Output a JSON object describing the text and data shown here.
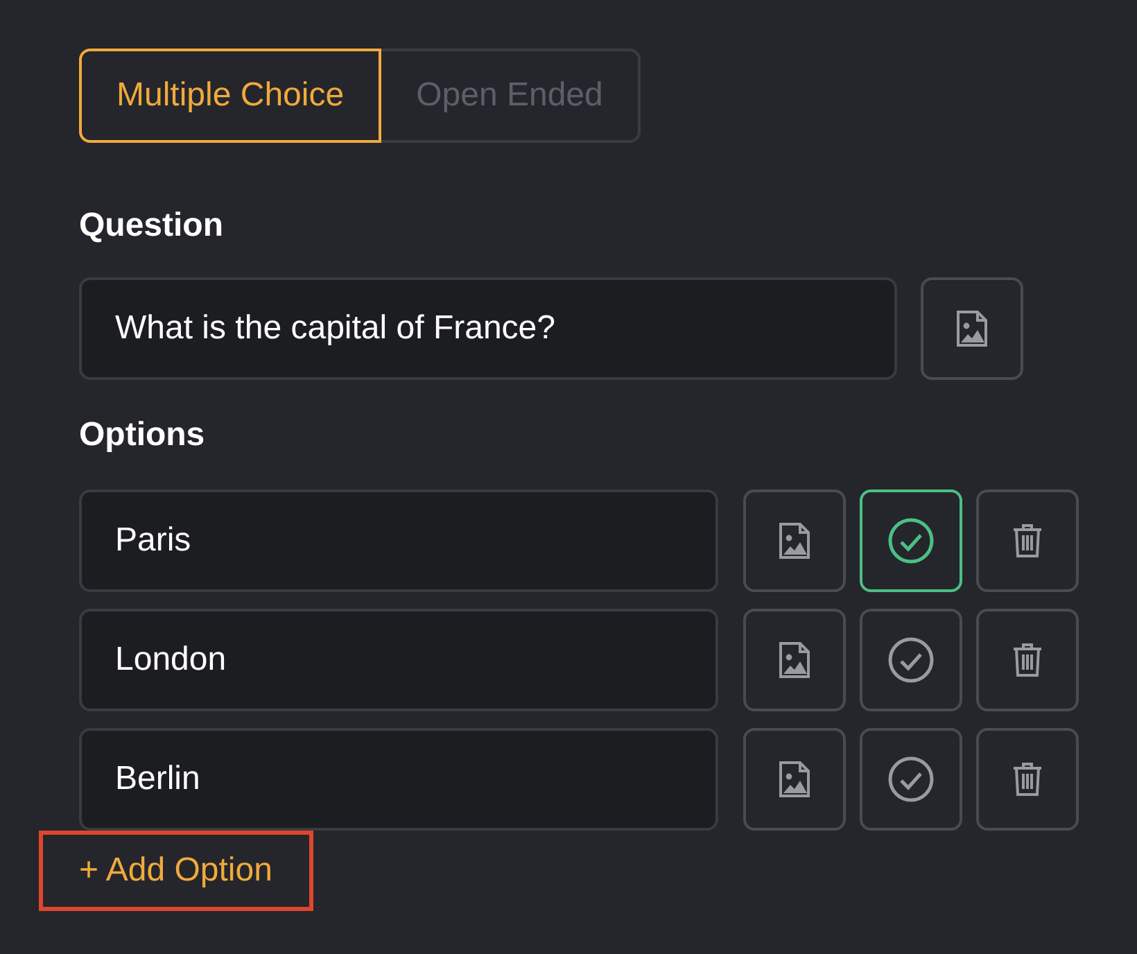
{
  "tabs": [
    {
      "label": "Multiple Choice",
      "selected": true
    },
    {
      "label": "Open Ended",
      "selected": false
    }
  ],
  "question": {
    "label": "Question",
    "value": "What is the capital of France?"
  },
  "options": {
    "label": "Options",
    "items": [
      {
        "value": "Paris",
        "correct": true
      },
      {
        "value": "London",
        "correct": false
      },
      {
        "value": "Berlin",
        "correct": false
      }
    ]
  },
  "add_option": {
    "label": "+ Add Option",
    "highlighted": true
  }
}
